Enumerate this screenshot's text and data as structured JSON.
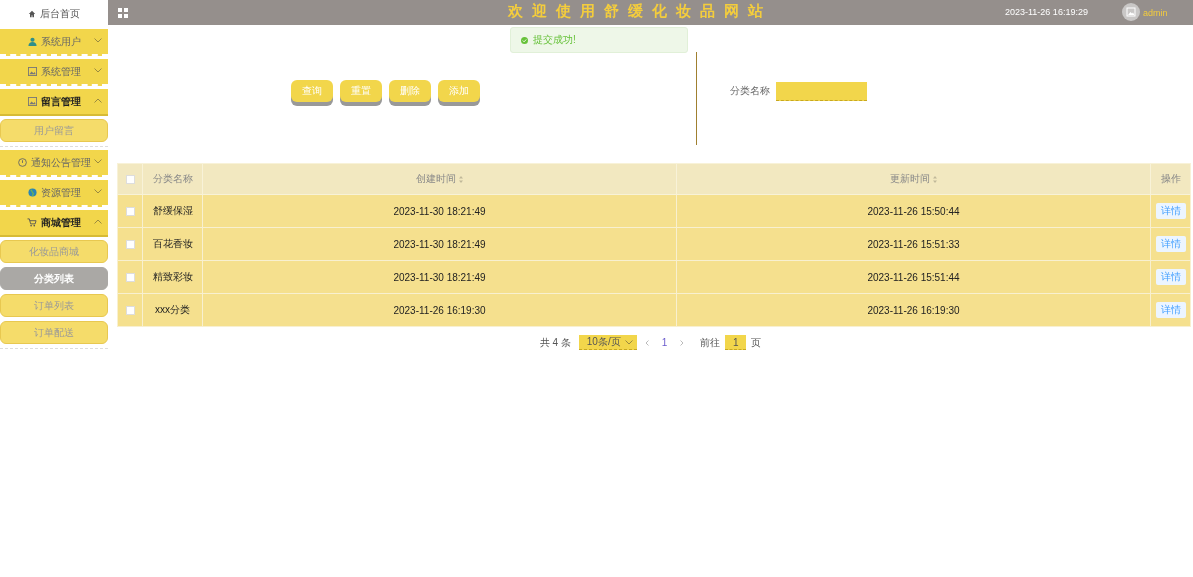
{
  "sidebar": {
    "home": {
      "label": "后台首页"
    },
    "menus": [
      {
        "label": "系统用户",
        "expanded": false
      },
      {
        "label": "系统管理",
        "expanded": false
      },
      {
        "label": "留言管理",
        "expanded": true,
        "children": [
          {
            "label": "用户留言",
            "selected": false
          }
        ]
      },
      {
        "label": "通知公告管理",
        "expanded": false
      },
      {
        "label": "资源管理",
        "expanded": false
      },
      {
        "label": "商城管理",
        "expanded": true,
        "children": [
          {
            "label": "化妆品商城",
            "selected": false
          },
          {
            "label": "分类列表",
            "selected": true
          },
          {
            "label": "订单列表",
            "selected": false
          },
          {
            "label": "订单配送",
            "selected": false
          }
        ]
      }
    ]
  },
  "topbar": {
    "title": "欢迎使用舒缓化妆品网站",
    "datetime": "2023-11-26 16:19:29",
    "user": "admin"
  },
  "toast": {
    "kind": "success",
    "message": "提交成功!"
  },
  "search": {
    "buttons": [
      "查询",
      "重置",
      "删除",
      "添加"
    ],
    "field_label": "分类名称"
  },
  "table": {
    "select_all": {
      "checked": false
    },
    "columns": [
      {
        "label": "分类名称",
        "sortable": false
      },
      {
        "label": "创建时间",
        "sortable": true
      },
      {
        "label": "更新时间",
        "sortable": true
      },
      {
        "label": "操作",
        "sortable": false
      }
    ],
    "rows": [
      {
        "checked": false,
        "cells": [
          "舒缓保湿",
          "2023-11-30 18:21:49",
          "2023-11-26 15:50:44"
        ],
        "action": "详情"
      },
      {
        "checked": false,
        "cells": [
          "百花香妆",
          "2023-11-30 18:21:49",
          "2023-11-26 15:51:33"
        ],
        "action": "详情"
      },
      {
        "checked": false,
        "cells": [
          "精致彩妆",
          "2023-11-30 18:21:49",
          "2023-11-26 15:51:44"
        ],
        "action": "详情"
      },
      {
        "checked": false,
        "cells": [
          "xxx分类",
          "2023-11-26 16:19:30",
          "2023-11-26 16:19:30"
        ],
        "action": "详情"
      }
    ]
  },
  "pager": {
    "total": "共 4 条",
    "page_size": "10条/页",
    "pages": [
      {
        "label": "1",
        "selected": true
      }
    ],
    "goto_label": "前往",
    "goto_value": "1",
    "goto_suffix": "页"
  }
}
